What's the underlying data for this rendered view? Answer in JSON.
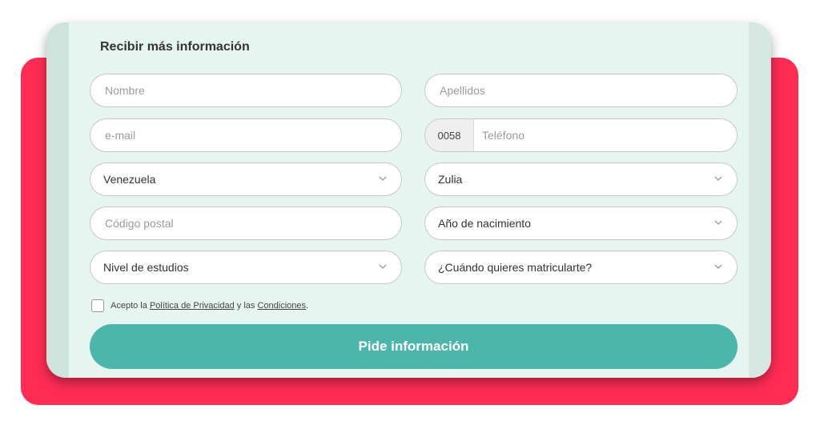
{
  "form": {
    "title": "Recibir más información",
    "nombre_placeholder": "Nombre",
    "apellidos_placeholder": "Apellidos",
    "email_placeholder": "e-mail",
    "phone_prefix": "0058",
    "phone_placeholder": "Teléfono",
    "country_value": "Venezuela",
    "state_value": "Zulia",
    "postal_placeholder": "Código postal",
    "birth_year_value": "Año de nacimiento",
    "education_value": "Nivel de estudios",
    "enroll_value": "¿Cuándo quieres matricularte?",
    "consent_prefix": "Acepto la",
    "privacy_link": "Política de Privacidad",
    "consent_middle": "y las",
    "conditions_link": "Condiciones",
    "consent_suffix": ".",
    "submit_label": "Pide información"
  },
  "colors": {
    "accent": "#4db6aa",
    "backdrop": "#fe2c55",
    "card": "#e7f5f1"
  }
}
